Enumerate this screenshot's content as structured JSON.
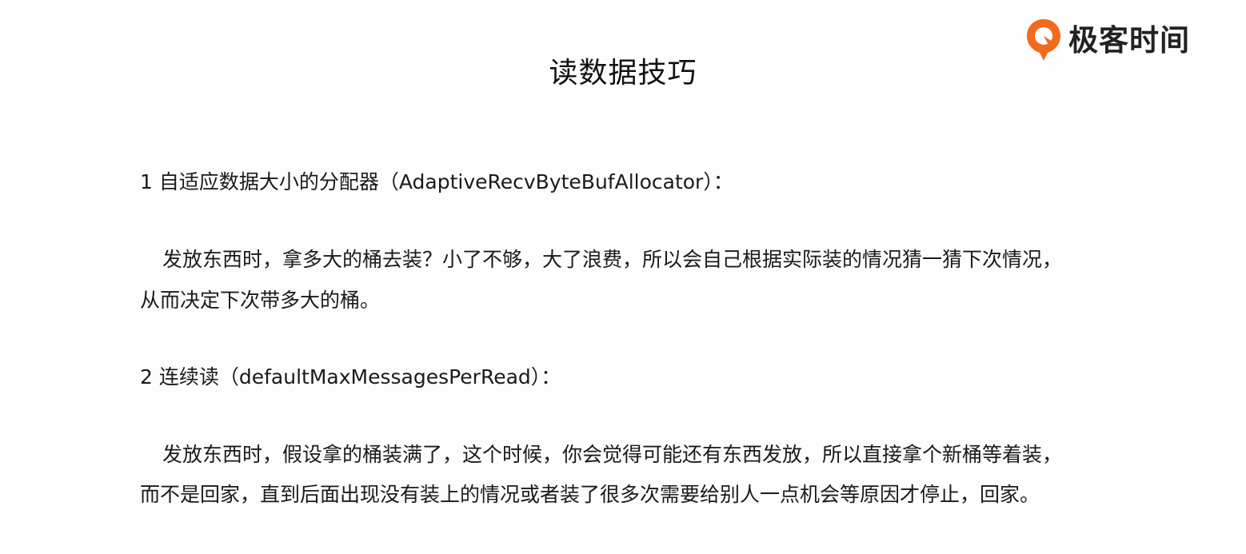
{
  "brand": {
    "name": "极客时间",
    "accent_color": "#f26b1d",
    "icon": "geektime-logo-icon"
  },
  "title": "读数据技巧",
  "sections": [
    {
      "heading": "1 自适应数据大小的分配器（AdaptiveRecvByteBufAllocator）：",
      "lines": [
        "发放东西时，拿多大的桶去装？小了不够，大了浪费，所以会自己根据实际装的情况猜一猜下次情况，",
        "从而决定下次带多大的桶。"
      ]
    },
    {
      "heading": "2 连续读（defaultMaxMessagesPerRead）：",
      "lines": [
        "发放东西时，假设拿的桶装满了，这个时候，你会觉得可能还有东西发放，所以直接拿个新桶等着装，",
        "而不是回家，直到后面出现没有装上的情况或者装了很多次需要给别人一点机会等原因才停止，回家。"
      ]
    }
  ]
}
